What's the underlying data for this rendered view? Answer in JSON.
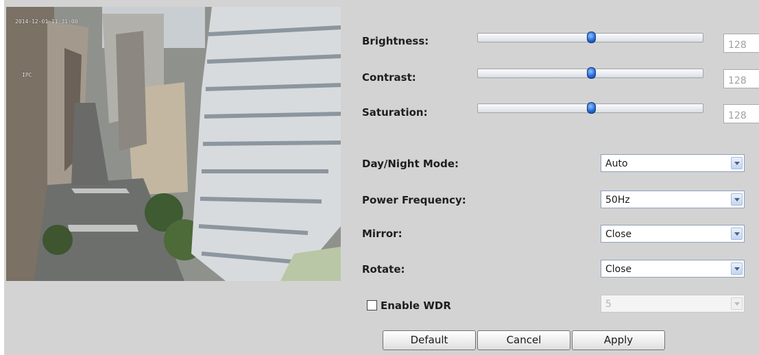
{
  "video": {
    "timestamp": "2014-12-01 11:31:00",
    "camera_name": "IPC"
  },
  "image_settings": {
    "brightness": {
      "label": "Brightness:",
      "value": "128",
      "max": 255
    },
    "contrast": {
      "label": "Contrast:",
      "value": "128",
      "max": 255
    },
    "saturation": {
      "label": "Saturation:",
      "value": "128",
      "max": 255
    }
  },
  "options": {
    "day_night": {
      "label": "Day/Night Mode:",
      "value": "Auto"
    },
    "power_freq": {
      "label": "Power Frequency:",
      "value": "50Hz"
    },
    "mirror": {
      "label": "Mirror:",
      "value": "Close"
    },
    "rotate": {
      "label": "Rotate:",
      "value": "Close"
    }
  },
  "wdr": {
    "label": "Enable WDR",
    "checked": false,
    "level": "5",
    "disabled": true
  },
  "buttons": {
    "default": "Default",
    "cancel": "Cancel",
    "apply": "Apply"
  },
  "colors": {
    "panel_bg": "#d3d3d3",
    "slider_thumb": "#2a6fd8"
  },
  "icons": {
    "slider_thumb": "slider-thumb-icon",
    "dropdown": "chevron-down-icon"
  }
}
